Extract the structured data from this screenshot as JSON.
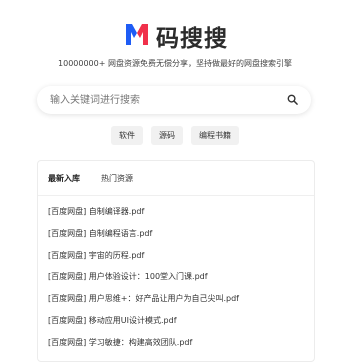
{
  "brand": {
    "name": "码搜搜"
  },
  "tagline": "10000000+ 网盘资源免费无偿分享，坚持做最好的网盘搜索引擎",
  "search": {
    "placeholder": "输入关键词进行搜索",
    "value": ""
  },
  "tags": [
    {
      "label": "软件"
    },
    {
      "label": "源码"
    },
    {
      "label": "编程书籍"
    }
  ],
  "tabs": [
    {
      "label": "最新入库",
      "active": true
    },
    {
      "label": "热门资源",
      "active": false
    }
  ],
  "items": [
    {
      "title": "[百度网盘] 自制编译器.pdf"
    },
    {
      "title": "[百度网盘] 自制编程语言.pdf"
    },
    {
      "title": "[百度网盘] 宇宙的历程.pdf"
    },
    {
      "title": "[百度网盘] 用户体验设计：100堂入门课.pdf"
    },
    {
      "title": "[百度网盘] 用户思维+：好产品让用户为自己尖叫.pdf"
    },
    {
      "title": "[百度网盘] 移动应用UI设计模式.pdf"
    },
    {
      "title": "[百度网盘] 学习敏捷：构建高效团队.pdf"
    }
  ],
  "colors": {
    "logo_blue": "#1e5cf5",
    "logo_red": "#f0304a",
    "accent_text": "#2b2b2b"
  },
  "icons": {
    "search": "search-icon",
    "logo": "logo-m-icon"
  }
}
